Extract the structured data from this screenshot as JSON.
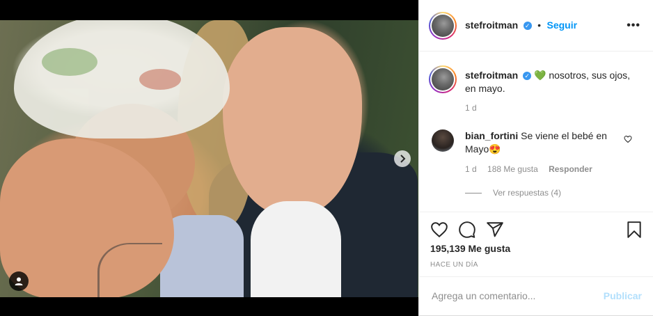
{
  "post": {
    "username": "stefroitman",
    "verified_symbol": "✓",
    "dot": "•",
    "follow_label": "Seguir",
    "more_label": "•••"
  },
  "caption": {
    "username": "stefroitman",
    "emoji": "💚",
    "text": "nosotros, sus ojos, en mayo.",
    "time": "1 d"
  },
  "comment": {
    "username": "bian_fortini",
    "text": "Se viene el bebé en Mayo",
    "emoji": "😍",
    "time": "1 d",
    "likes": "188 Me gusta",
    "reply_label": "Responder",
    "view_replies": "Ver respuestas (4)"
  },
  "actions": {
    "icons": [
      "heart-icon",
      "comment-icon",
      "share-icon",
      "bookmark-icon"
    ],
    "likes_count": "195,139 Me gusta",
    "posted_ago": "HACE UN DÍA"
  },
  "add_comment": {
    "placeholder": "Agrega un comentario...",
    "publish_label": "Publicar"
  },
  "colors": {
    "accent": "#0095f6",
    "publish_disabled": "#b2dffc",
    "muted": "#8e8e8e",
    "text": "#262626"
  }
}
